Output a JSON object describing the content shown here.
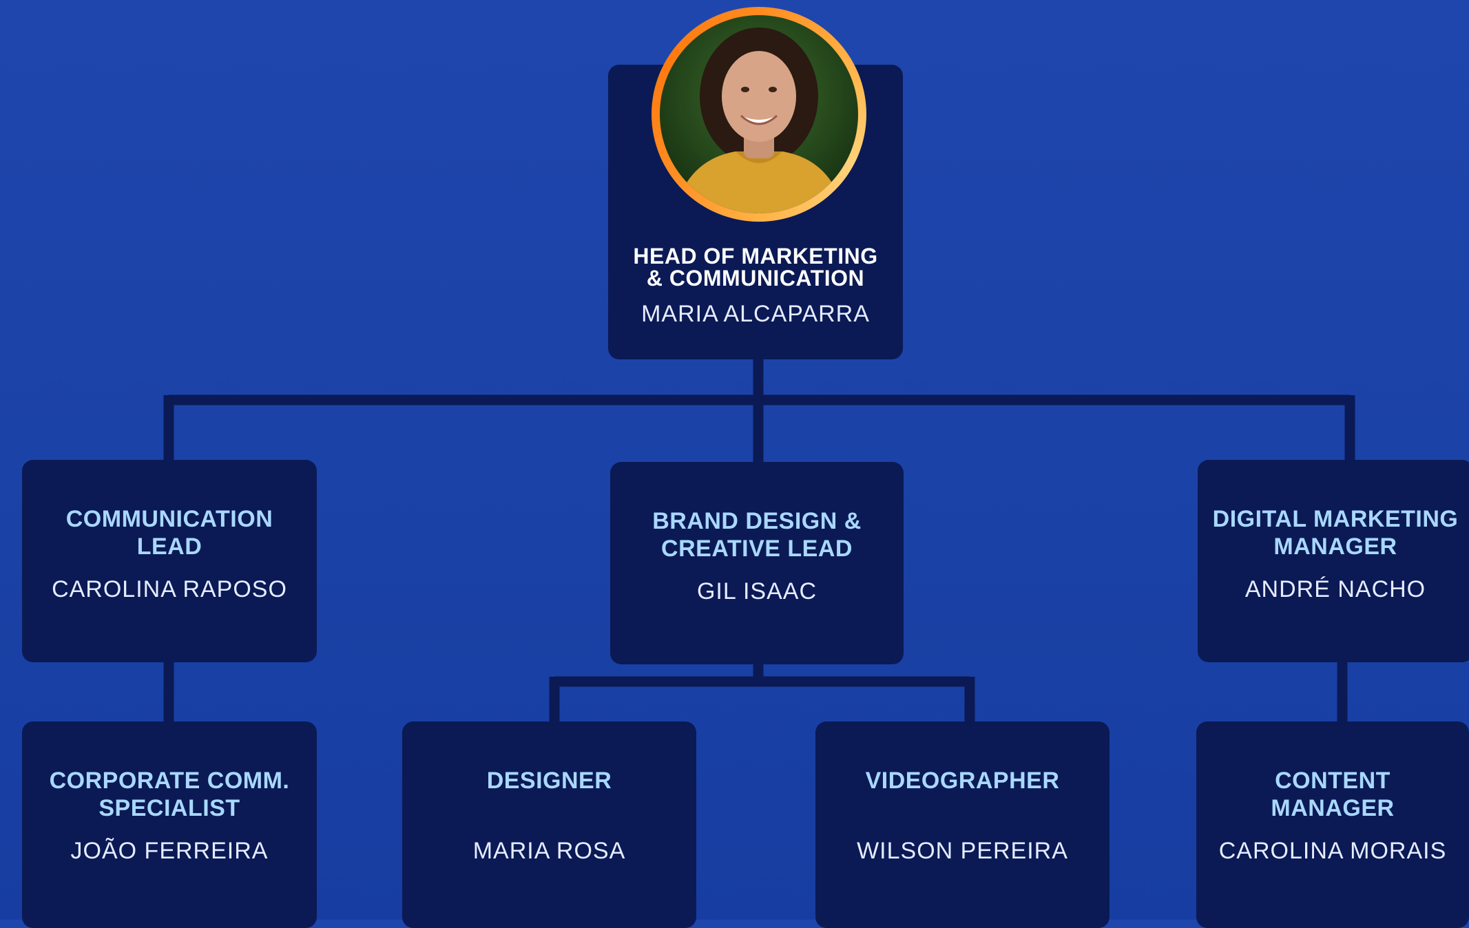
{
  "head": {
    "title": "HEAD OF MARKETING\n& COMMUNICATION",
    "name": "MARIA ALCAPARRA",
    "photo": "portrait-photo"
  },
  "level2": [
    {
      "title": "COMMUNICATION\nLEAD",
      "name": "CAROLINA RAPOSO"
    },
    {
      "title": "BRAND DESIGN &\nCREATIVE LEAD",
      "name": "GIL ISAAC"
    },
    {
      "title": "DIGITAL MARKETING\nMANAGER",
      "name": "ANDRÉ NACHO"
    }
  ],
  "level3": [
    {
      "title": "CORPORATE COMM.\nSPECIALIST",
      "name": "JOÃO FERREIRA"
    },
    {
      "title": "DESIGNER",
      "name": "MARIA ROSA"
    },
    {
      "title": "VIDEOGRAPHER",
      "name": "WILSON PEREIRA"
    },
    {
      "title": "CONTENT\nMANAGER",
      "name": "CAROLINA MORAIS"
    }
  ],
  "colors": {
    "background": "#1f46ad",
    "card": "#0b1a55",
    "connector": "#0b1a55",
    "title": "#a9d8ff",
    "head_title": "#ffffff",
    "name": "#e6ecff",
    "avatar_ring": "#ff8a1f"
  }
}
